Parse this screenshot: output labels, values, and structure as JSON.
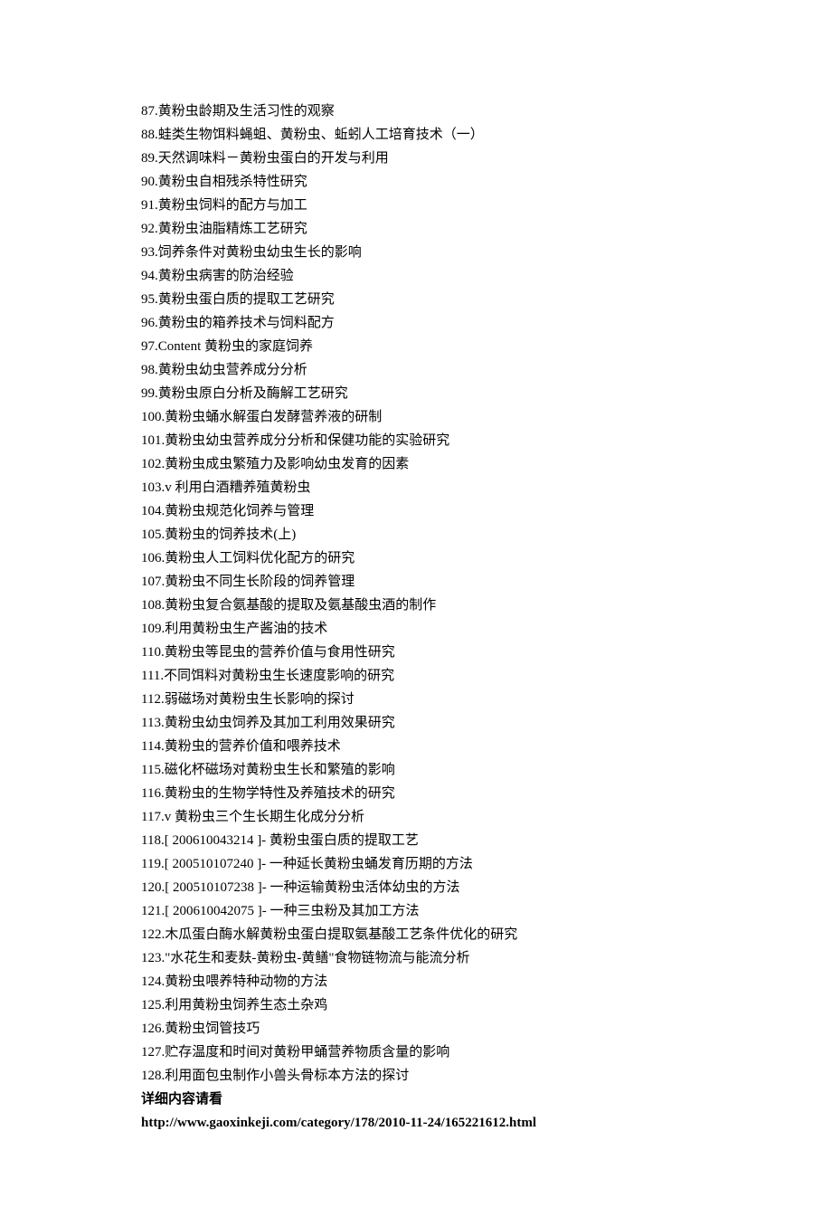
{
  "items": [
    "87.黄粉虫龄期及生活习性的观察",
    "88.蛙类生物饵料蝇蛆、黄粉虫、蚯蚓人工培育技术（一）",
    "89.天然调味料－黄粉虫蛋白的开发与利用",
    "90.黄粉虫自相残杀特性研究",
    "91.黄粉虫饲料的配方与加工",
    "92.黄粉虫油脂精炼工艺研究",
    "93.饲养条件对黄粉虫幼虫生长的影响",
    "94.黄粉虫病害的防治经验",
    "95.黄粉虫蛋白质的提取工艺研究",
    "96.黄粉虫的箱养技术与饲料配方",
    "97.Content 黄粉虫的家庭饲养",
    "98.黄粉虫幼虫营养成分分析",
    "99.黄粉虫原白分析及酶解工艺研究",
    "100.黄粉虫蛹水解蛋白发酵营养液的研制",
    "101.黄粉虫幼虫营养成分分析和保健功能的实验研究",
    "102.黄粉虫成虫繁殖力及影响幼虫发育的因素",
    "103.v 利用白酒糟养殖黄粉虫",
    "104.黄粉虫规范化饲养与管理",
    "105.黄粉虫的饲养技术(上)",
    "106.黄粉虫人工饲料优化配方的研究",
    "107.黄粉虫不同生长阶段的饲养管理",
    "108.黄粉虫复合氨基酸的提取及氨基酸虫酒的制作",
    "109.利用黄粉虫生产酱油的技术",
    "110.黄粉虫等昆虫的营养价值与食用性研究",
    "111.不同饵料对黄粉虫生长速度影响的研究",
    "112.弱磁场对黄粉虫生长影响的探讨",
    "113.黄粉虫幼虫饲养及其加工利用效果研究",
    "114.黄粉虫的营养价值和喂养技术",
    "115.磁化杯磁场对黄粉虫生长和繁殖的影响",
    "116.黄粉虫的生物学特性及养殖技术的研究",
    "117.v 黄粉虫三个生长期生化成分分析",
    "118.[ 200610043214 ]- 黄粉虫蛋白质的提取工艺",
    "119.[ 200510107240 ]- 一种延长黄粉虫蛹发育历期的方法",
    "120.[ 200510107238 ]- 一种运输黄粉虫活体幼虫的方法",
    "121.[ 200610042075 ]- 一种三虫粉及其加工方法",
    "122.木瓜蛋白酶水解黄粉虫蛋白提取氨基酸工艺条件优化的研究",
    "123.\"水花生和麦麸-黄粉虫-黄鳝\"食物链物流与能流分析",
    "124.黄粉虫喂养特种动物的方法",
    "125.利用黄粉虫饲养生态土杂鸡",
    "126.黄粉虫饲管技巧",
    "127.贮存温度和时间对黄粉甲蛹营养物质含量的影响",
    "128.利用面包虫制作小兽头骨标本方法的探讨"
  ],
  "footer_label": "详细内容请看",
  "footer_url": "http://www.gaoxinkeji.com/category/178/2010-11-24/165221612.html"
}
